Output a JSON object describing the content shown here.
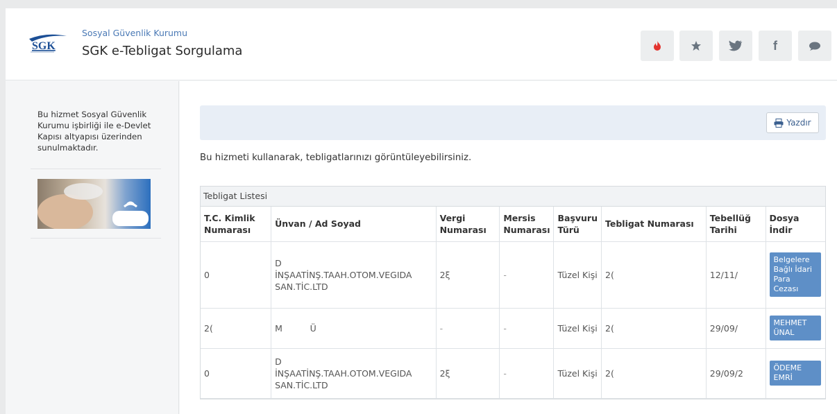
{
  "header": {
    "org_name": "Sosyal Güvenlik Kurumu",
    "title": "SGK e-Tebligat Sorgulama",
    "logo_text": "SGK"
  },
  "social": [
    {
      "icon": "fire-icon",
      "glyph": "🔥"
    },
    {
      "icon": "star-icon",
      "glyph": "★"
    },
    {
      "icon": "twitter-icon",
      "glyph": "🐦"
    },
    {
      "icon": "facebook-icon",
      "glyph": "f"
    },
    {
      "icon": "comment-icon",
      "glyph": "💬"
    }
  ],
  "sidebar": {
    "info": "Bu hizmet Sosyal Güvenlik Kurumu işbirliği ile e-Devlet Kapısı altyapısı üzerinden sunulmaktadır."
  },
  "toolbar": {
    "print_label": "Yazdır"
  },
  "intro": "Bu hizmeti kullanarak, tebligatlarınızı görüntüleyebilirsiniz.",
  "list": {
    "title": "Tebligat Listesi",
    "columns": [
      "T.C. Kimlik Numarası",
      "Ünvan / Ad Soyad",
      "Vergi Numarası",
      "Mersis Numarası",
      "Başvuru Türü",
      "Tebligat Numarası",
      "Tebellüğ Tarihi",
      "Dosya İndir"
    ],
    "rows": [
      {
        "tc": "0",
        "name": "D\nİNŞAATİNŞ.TAAH.OTOM.VEGIDA SAN.TİC.LTD",
        "vergi": "2ξ",
        "mersis": "-",
        "type": "Tüzel Kişi",
        "tebligat": "2(",
        "date": "12/11/",
        "doc": "Belgelere Bağlı İdari Para Cezası"
      },
      {
        "tc": "2(",
        "name": "M          Ü",
        "vergi": "-",
        "mersis": "-",
        "type": "Tüzel Kişi",
        "tebligat": "2(",
        "date": "29/09/",
        "doc": "MEHMET ÜNAL"
      },
      {
        "tc": "0",
        "name": "D\nİNŞAATİNŞ.TAAH.OTOM.VEGIDA SAN.TİC.LTD",
        "vergi": "2ξ",
        "mersis": "-",
        "type": "Tüzel Kişi",
        "tebligat": "2(",
        "date": "29/09/2",
        "doc": "ÖDEME EMRİ"
      }
    ]
  }
}
